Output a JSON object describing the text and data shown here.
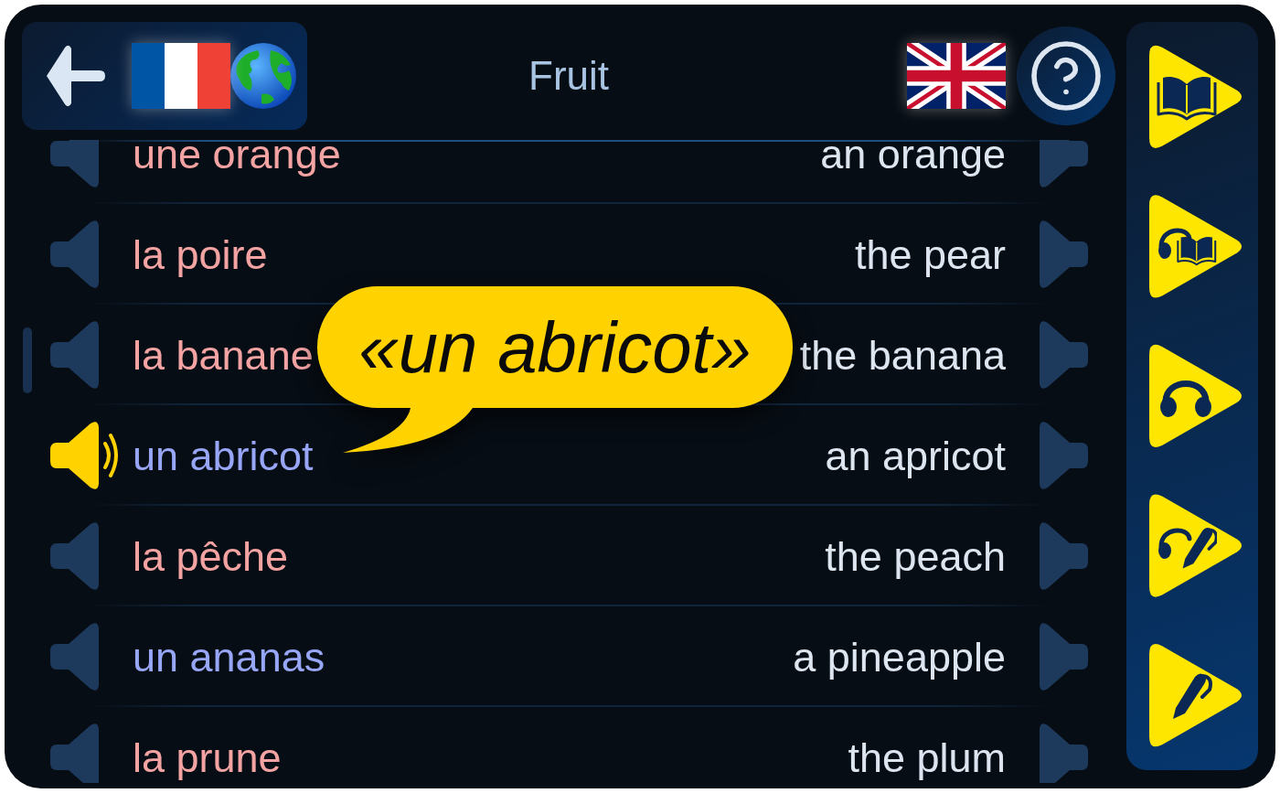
{
  "header": {
    "title": "Fruit"
  },
  "rows": [
    {
      "french": "une orange",
      "english": "an orange",
      "color": "#f4a3a3",
      "speaking": false
    },
    {
      "french": "la poire",
      "english": "the pear",
      "color": "#f4a3a3",
      "speaking": false
    },
    {
      "french": "la banane",
      "english": "the banana",
      "color": "#f4a3a3",
      "speaking": false
    },
    {
      "french": "un abricot",
      "english": "an apricot",
      "color": "#97a6f6",
      "speaking": true
    },
    {
      "french": "la pêche",
      "english": "the peach",
      "color": "#f4a3a3",
      "speaking": false
    },
    {
      "french": "un ananas",
      "english": "a pineapple",
      "color": "#97a6f6",
      "speaking": false
    },
    {
      "french": "la prune",
      "english": "the plum",
      "color": "#f4a3a3",
      "speaking": false
    }
  ],
  "speech_bubble": {
    "text": "«un abricot»"
  },
  "mode_buttons": [
    {
      "kind": "read"
    },
    {
      "kind": "audiobook"
    },
    {
      "kind": "listen"
    },
    {
      "kind": "dictation"
    },
    {
      "kind": "write"
    }
  ]
}
